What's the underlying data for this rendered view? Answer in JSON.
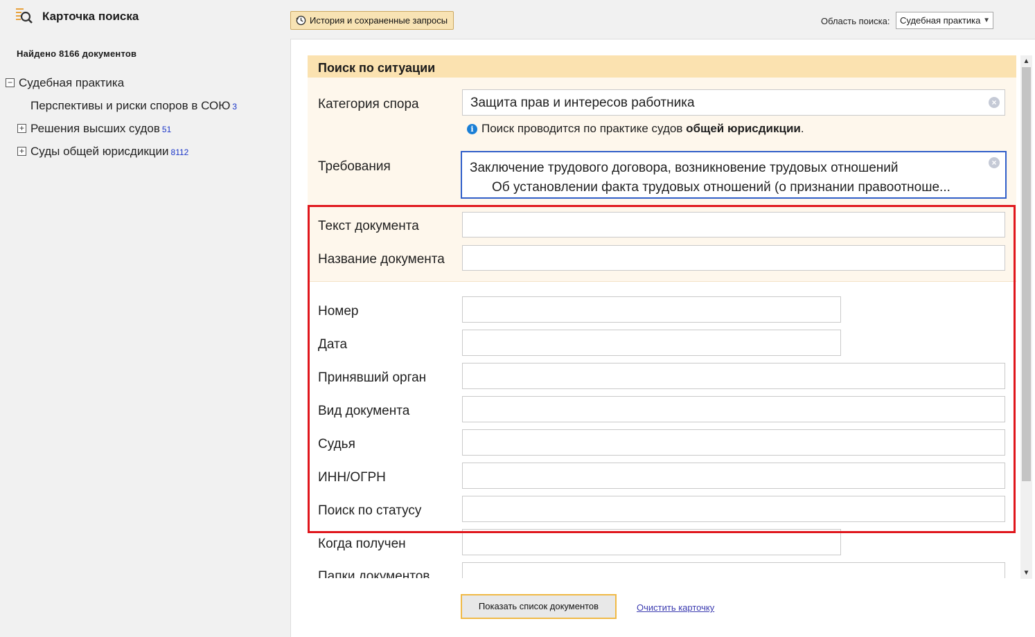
{
  "left_panel": {
    "title": "Карточка поиска",
    "found": "Найдено 8166 документов",
    "tree": {
      "root": {
        "label": "Судебная практика"
      },
      "items": [
        {
          "label": "Перспективы и риски споров в СОЮ",
          "count": "3"
        },
        {
          "label": "Решения высших судов",
          "count": "51"
        },
        {
          "label": "Суды общей юрисдикции",
          "count": "8112"
        }
      ]
    }
  },
  "toolbar": {
    "history_button": "История и сохраненные запросы",
    "area_label": "Область поиска:",
    "area_value": "Судебная практика"
  },
  "card": {
    "header": "Поиск по ситуации",
    "fields": {
      "category": {
        "label": "Категория спора",
        "value": "Защита прав и интересов работника"
      },
      "info": {
        "prefix": "Поиск проводится по практике судов ",
        "bold": "общей юрисдикции",
        "suffix": "."
      },
      "requirements": {
        "label": "Требования",
        "line1": "Заключение трудового договора, возникновение трудовых отношений",
        "line2": "Об установлении факта трудовых отношений (о признании правоотноше..."
      },
      "doc_text": {
        "label": "Текст документа",
        "value": ""
      },
      "doc_name": {
        "label": "Название документа",
        "value": ""
      },
      "number": {
        "label": "Номер",
        "value": ""
      },
      "date": {
        "label": "Дата",
        "value": ""
      },
      "authority": {
        "label": "Принявший орган",
        "value": ""
      },
      "doc_type": {
        "label": "Вид документа",
        "value": ""
      },
      "judge": {
        "label": "Судья",
        "value": ""
      },
      "inn": {
        "label": "ИНН/ОГРН",
        "value": ""
      },
      "status": {
        "label": "Поиск по статусу",
        "value": ""
      },
      "received": {
        "label": "Когда получен",
        "value": ""
      },
      "folders": {
        "label": "Папки документов",
        "value": ""
      }
    }
  },
  "bottom": {
    "show_button": "Показать список документов",
    "clear_link": "Очистить карточку"
  },
  "colors": {
    "header_bg": "#fbe2b0",
    "highlight": "#e0161c",
    "link": "#3b3bb0",
    "active_border": "#2f5ec9"
  }
}
